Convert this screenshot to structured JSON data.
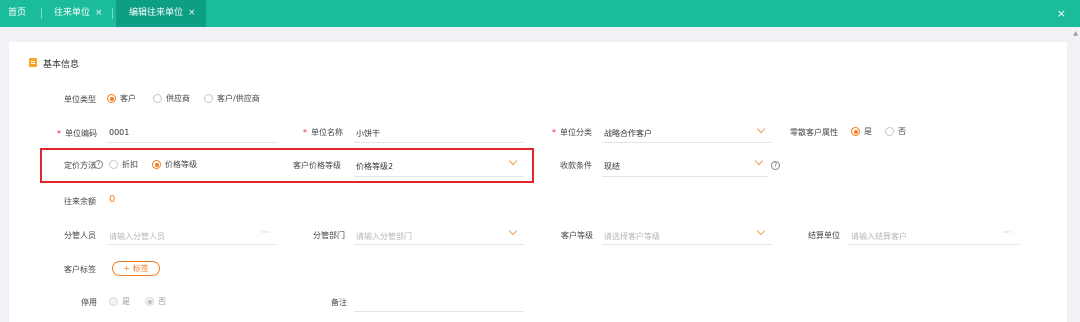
{
  "tabs": [
    {
      "label": "首页",
      "closable": false,
      "active": false
    },
    {
      "label": "往来单位",
      "closable": true,
      "active": false
    },
    {
      "label": "编辑往来单位",
      "closable": true,
      "active": true
    }
  ],
  "close_glyph": "×",
  "section": {
    "title": "基本信息",
    "icon": "document-icon"
  },
  "fields": {
    "unit_type": {
      "label": "单位类型",
      "options": [
        "客户",
        "供应商",
        "客户/供应商"
      ],
      "selected": "客户"
    },
    "unit_code": {
      "label": "单位编码",
      "value": "0001",
      "required": true
    },
    "unit_name": {
      "label": "单位名称",
      "value": "小饼干",
      "required": true
    },
    "unit_category": {
      "label": "单位分类",
      "value": "战略合作客户",
      "required": true
    },
    "retail_attr": {
      "label": "零散客户属性",
      "options": [
        "是",
        "否"
      ],
      "selected": "是"
    },
    "pricing_method": {
      "label": "定价方法",
      "options": [
        "折扣",
        "价格等级"
      ],
      "selected": "价格等级"
    },
    "price_level": {
      "label": "客户价格等级",
      "value": "价格等级2"
    },
    "payment_terms": {
      "label": "收款条件",
      "value": "现结"
    },
    "balance": {
      "label": "往来余额",
      "value": "0"
    },
    "manager": {
      "label": "分管人员",
      "placeholder": "请输入分管人员"
    },
    "department": {
      "label": "分管部门",
      "placeholder": "请输入分管部门"
    },
    "customer_level": {
      "label": "客户等级",
      "placeholder": "请选择客户等级"
    },
    "settlement_unit": {
      "label": "结算单位",
      "placeholder": "请输入结算客户"
    },
    "customer_tag": {
      "label": "客户标签",
      "button": "+ 标签"
    },
    "disabled": {
      "label": "停用",
      "options": [
        "是",
        "否"
      ],
      "selected": "否"
    },
    "remark": {
      "label": "备注",
      "value": ""
    }
  },
  "help_glyph": "?",
  "more_glyph": "···",
  "colors": {
    "accent": "#f57c21",
    "topbar": "#1bbc9b",
    "highlight": "#e0262c"
  }
}
